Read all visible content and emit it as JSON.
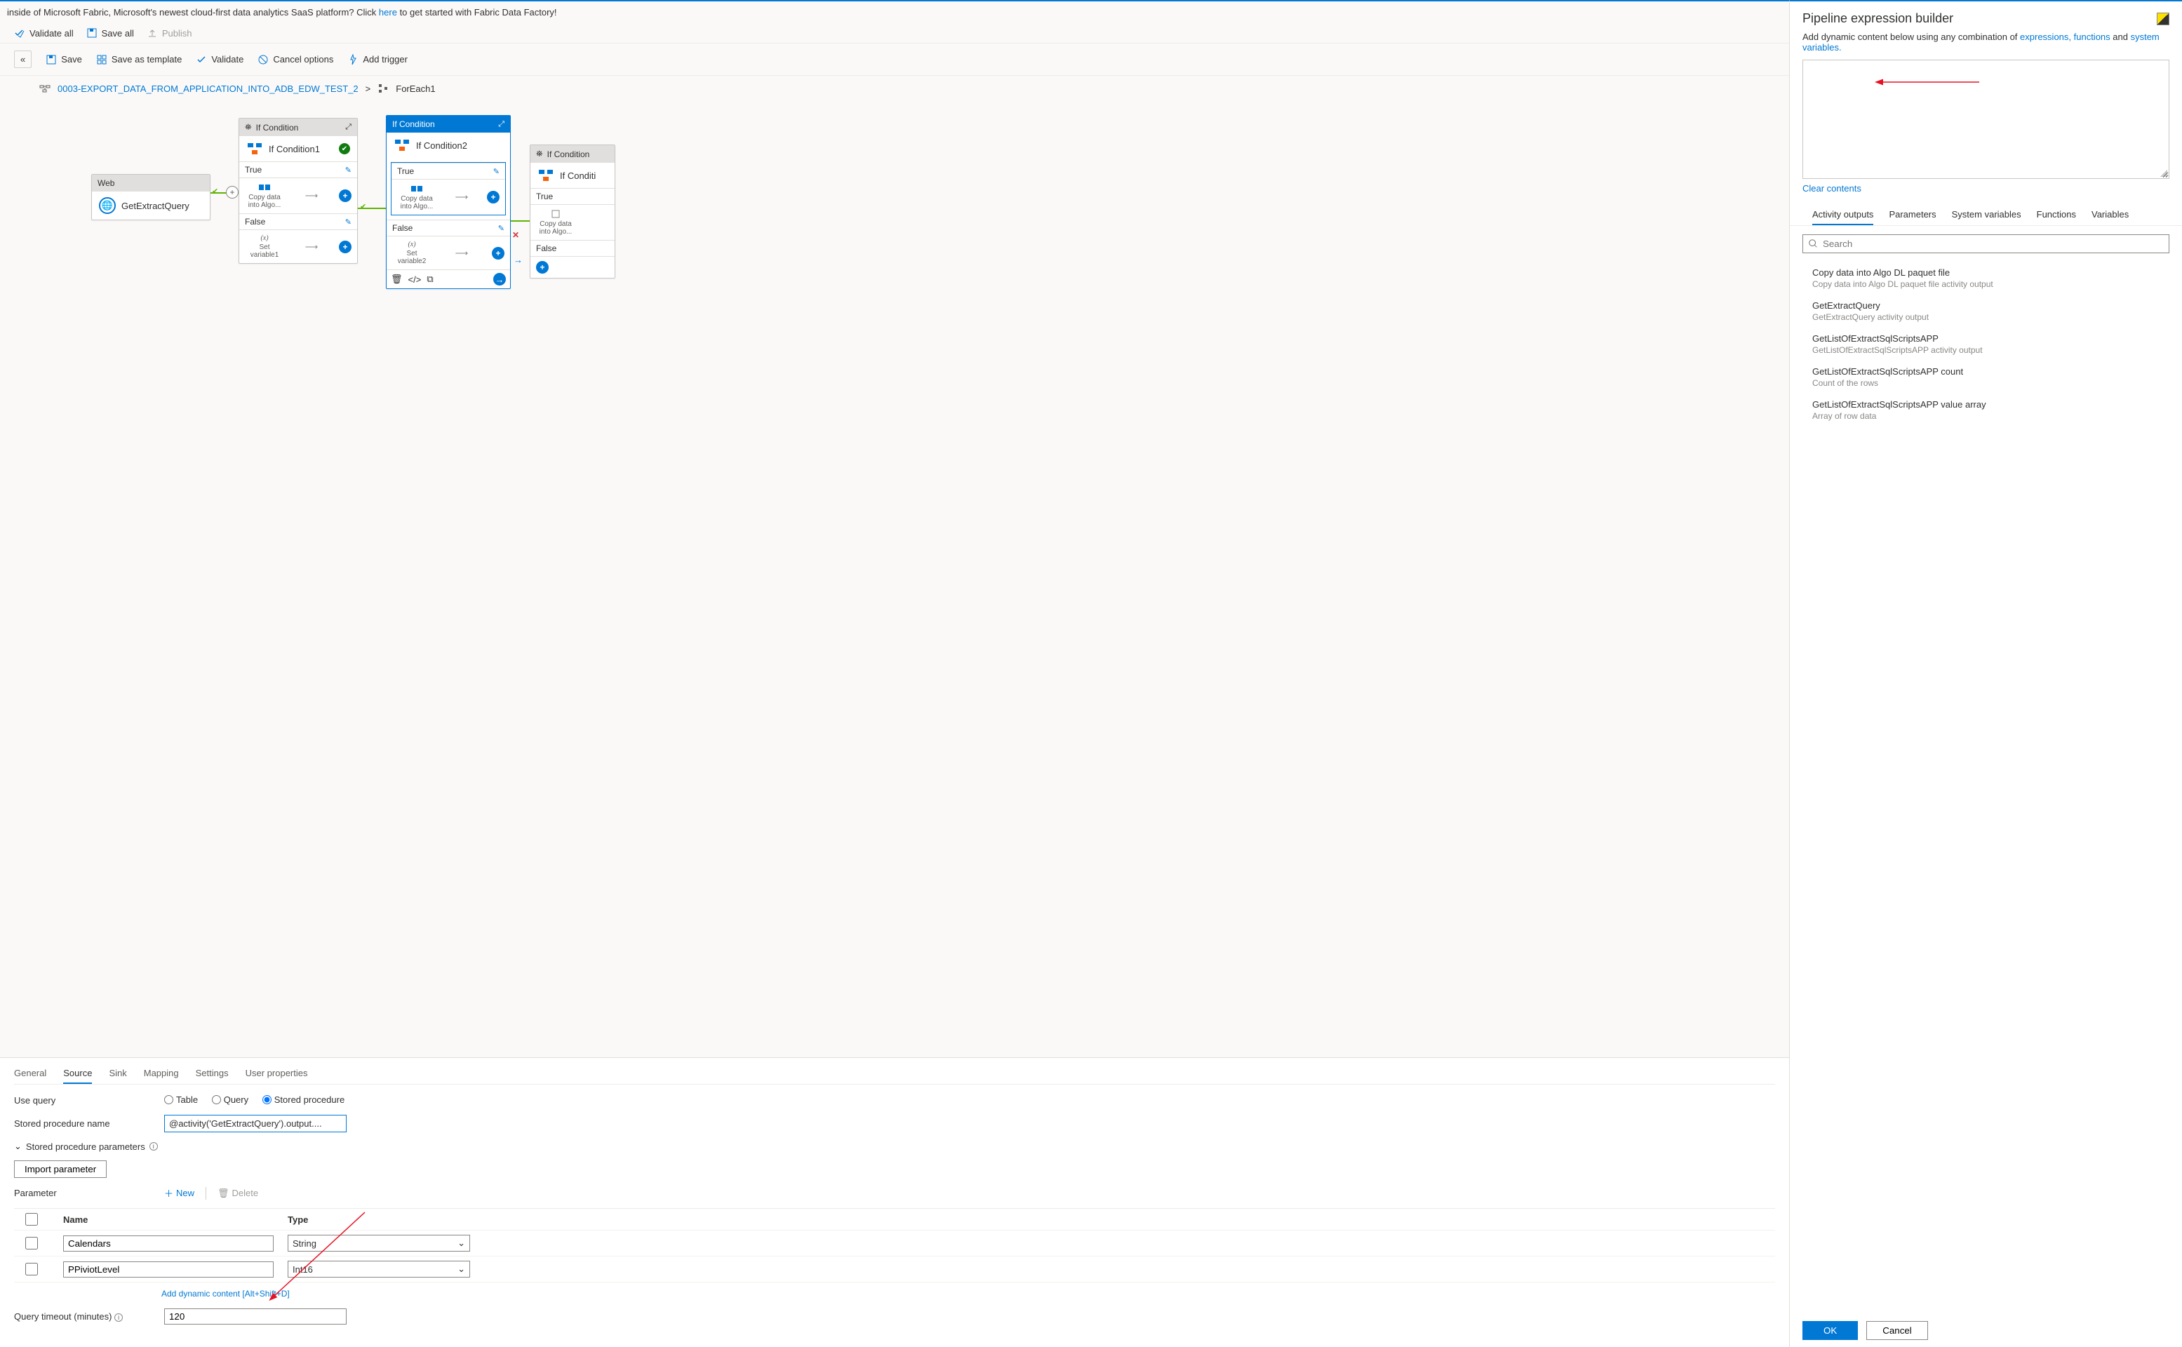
{
  "banner": {
    "prefix": "inside of Microsoft Fabric, Microsoft's newest cloud-first data analytics SaaS platform? Click ",
    "link": "here",
    "suffix": " to get started with Fabric Data Factory!"
  },
  "topbar": {
    "validate_all": "Validate all",
    "save_all": "Save all",
    "publish": "Publish"
  },
  "actionbar": {
    "save": "Save",
    "save_template": "Save as template",
    "validate": "Validate",
    "cancel_options": "Cancel options",
    "add_trigger": "Add trigger"
  },
  "breadcrumb": {
    "pipeline": "0003-EXPORT_DATA_FROM_APPLICATION_INTO_ADB_EDW_TEST_2",
    "current": "ForEach1"
  },
  "canvas": {
    "web": {
      "type": "Web",
      "name": "GetExtractQuery"
    },
    "if1": {
      "type": "If Condition",
      "name": "If Condition1",
      "true_label": "True",
      "false_label": "False",
      "true_node": "Copy data into Algo...",
      "false_node": "Set variable1"
    },
    "if2": {
      "type": "If Condition",
      "name": "If Condition2",
      "true_label": "True",
      "false_label": "False",
      "true_node": "Copy data into Algo...",
      "false_node": "Set variable2"
    },
    "if3": {
      "type": "If Condition",
      "name": "If Conditi",
      "true_label": "True",
      "false_label": "False",
      "true_node": "Copy data into Algo..."
    }
  },
  "bottom": {
    "tabs": [
      "General",
      "Source",
      "Sink",
      "Mapping",
      "Settings",
      "User properties"
    ],
    "active_tab": "Source",
    "use_query_label": "Use query",
    "query_options": {
      "table": "Table",
      "query": "Query",
      "sp": "Stored procedure"
    },
    "selected_query": "sp",
    "sp_name_label": "Stored procedure name",
    "sp_name_value": "@activity('GetExtractQuery').output....",
    "sp_params_label": "Stored procedure parameters",
    "import_param": "Import parameter",
    "parameter_label": "Parameter",
    "new_label": "New",
    "delete_label": "Delete",
    "col_name": "Name",
    "col_type": "Type",
    "rows": [
      {
        "name": "Calendars",
        "type": "String"
      },
      {
        "name": "PPiviotLevel",
        "type": "Int16"
      }
    ],
    "add_dynamic": "Add dynamic content [Alt+Shift+D]",
    "qt_label": "Query timeout (minutes)",
    "qt_value": "120"
  },
  "sidepanel": {
    "title": "Pipeline expression builder",
    "sub_prefix": "Add dynamic content below using any combination of ",
    "sub_link1": "expressions, functions",
    "sub_mid": " and ",
    "sub_link2": "system variables.",
    "clear": "Clear contents",
    "tabs": [
      "Activity outputs",
      "Parameters",
      "System variables",
      "Functions",
      "Variables"
    ],
    "active_tab": "Activity outputs",
    "search_placeholder": "Search",
    "items": [
      {
        "t": "Copy data into Algo DL paquet file",
        "d": "Copy data into Algo DL paquet file activity output"
      },
      {
        "t": "GetExtractQuery",
        "d": "GetExtractQuery activity output"
      },
      {
        "t": "GetListOfExtractSqlScriptsAPP",
        "d": "GetListOfExtractSqlScriptsAPP activity output"
      },
      {
        "t": "GetListOfExtractSqlScriptsAPP count",
        "d": "Count of the rows"
      },
      {
        "t": "GetListOfExtractSqlScriptsAPP value array",
        "d": "Array of row data"
      }
    ],
    "ok": "OK",
    "cancel": "Cancel"
  }
}
